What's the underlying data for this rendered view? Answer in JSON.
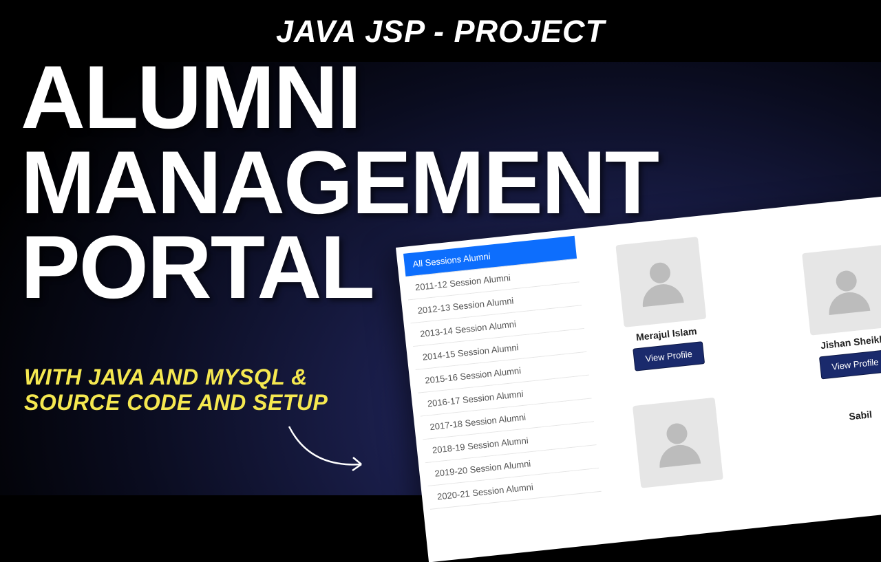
{
  "topbar": "JAVA JSP - PROJECT",
  "title": {
    "line1": "ALUMNI",
    "line2": "MANAGEMENT",
    "line3": "PORTAL"
  },
  "subtitle": {
    "line1": "WITH JAVA AND MYSQL &",
    "line2": "SOURCE CODE AND SETUP"
  },
  "sessions": {
    "active": "All Sessions Alumni",
    "items": [
      "2011-12 Session Alumni",
      "2012-13 Session Alumni",
      "2013-14 Session Alumni",
      "2014-15 Session Alumni",
      "2015-16 Session Alumni",
      "2016-17 Session Alumni",
      "2017-18 Session Alumni",
      "2018-19 Session Alumni",
      "2019-20 Session Alumni",
      "2020-21 Session Alumni"
    ]
  },
  "alumni": [
    {
      "name": "Merajul Islam",
      "button": "View Profile"
    },
    {
      "name": "Jishan Sheikh",
      "button": "View Profile"
    },
    {
      "name": "",
      "button": ""
    },
    {
      "name": "Sabil",
      "button": ""
    }
  ],
  "colors": {
    "accent_blue": "#0d6efd",
    "button_navy": "#1a2a6c",
    "subtitle_yellow": "#f5e850"
  }
}
